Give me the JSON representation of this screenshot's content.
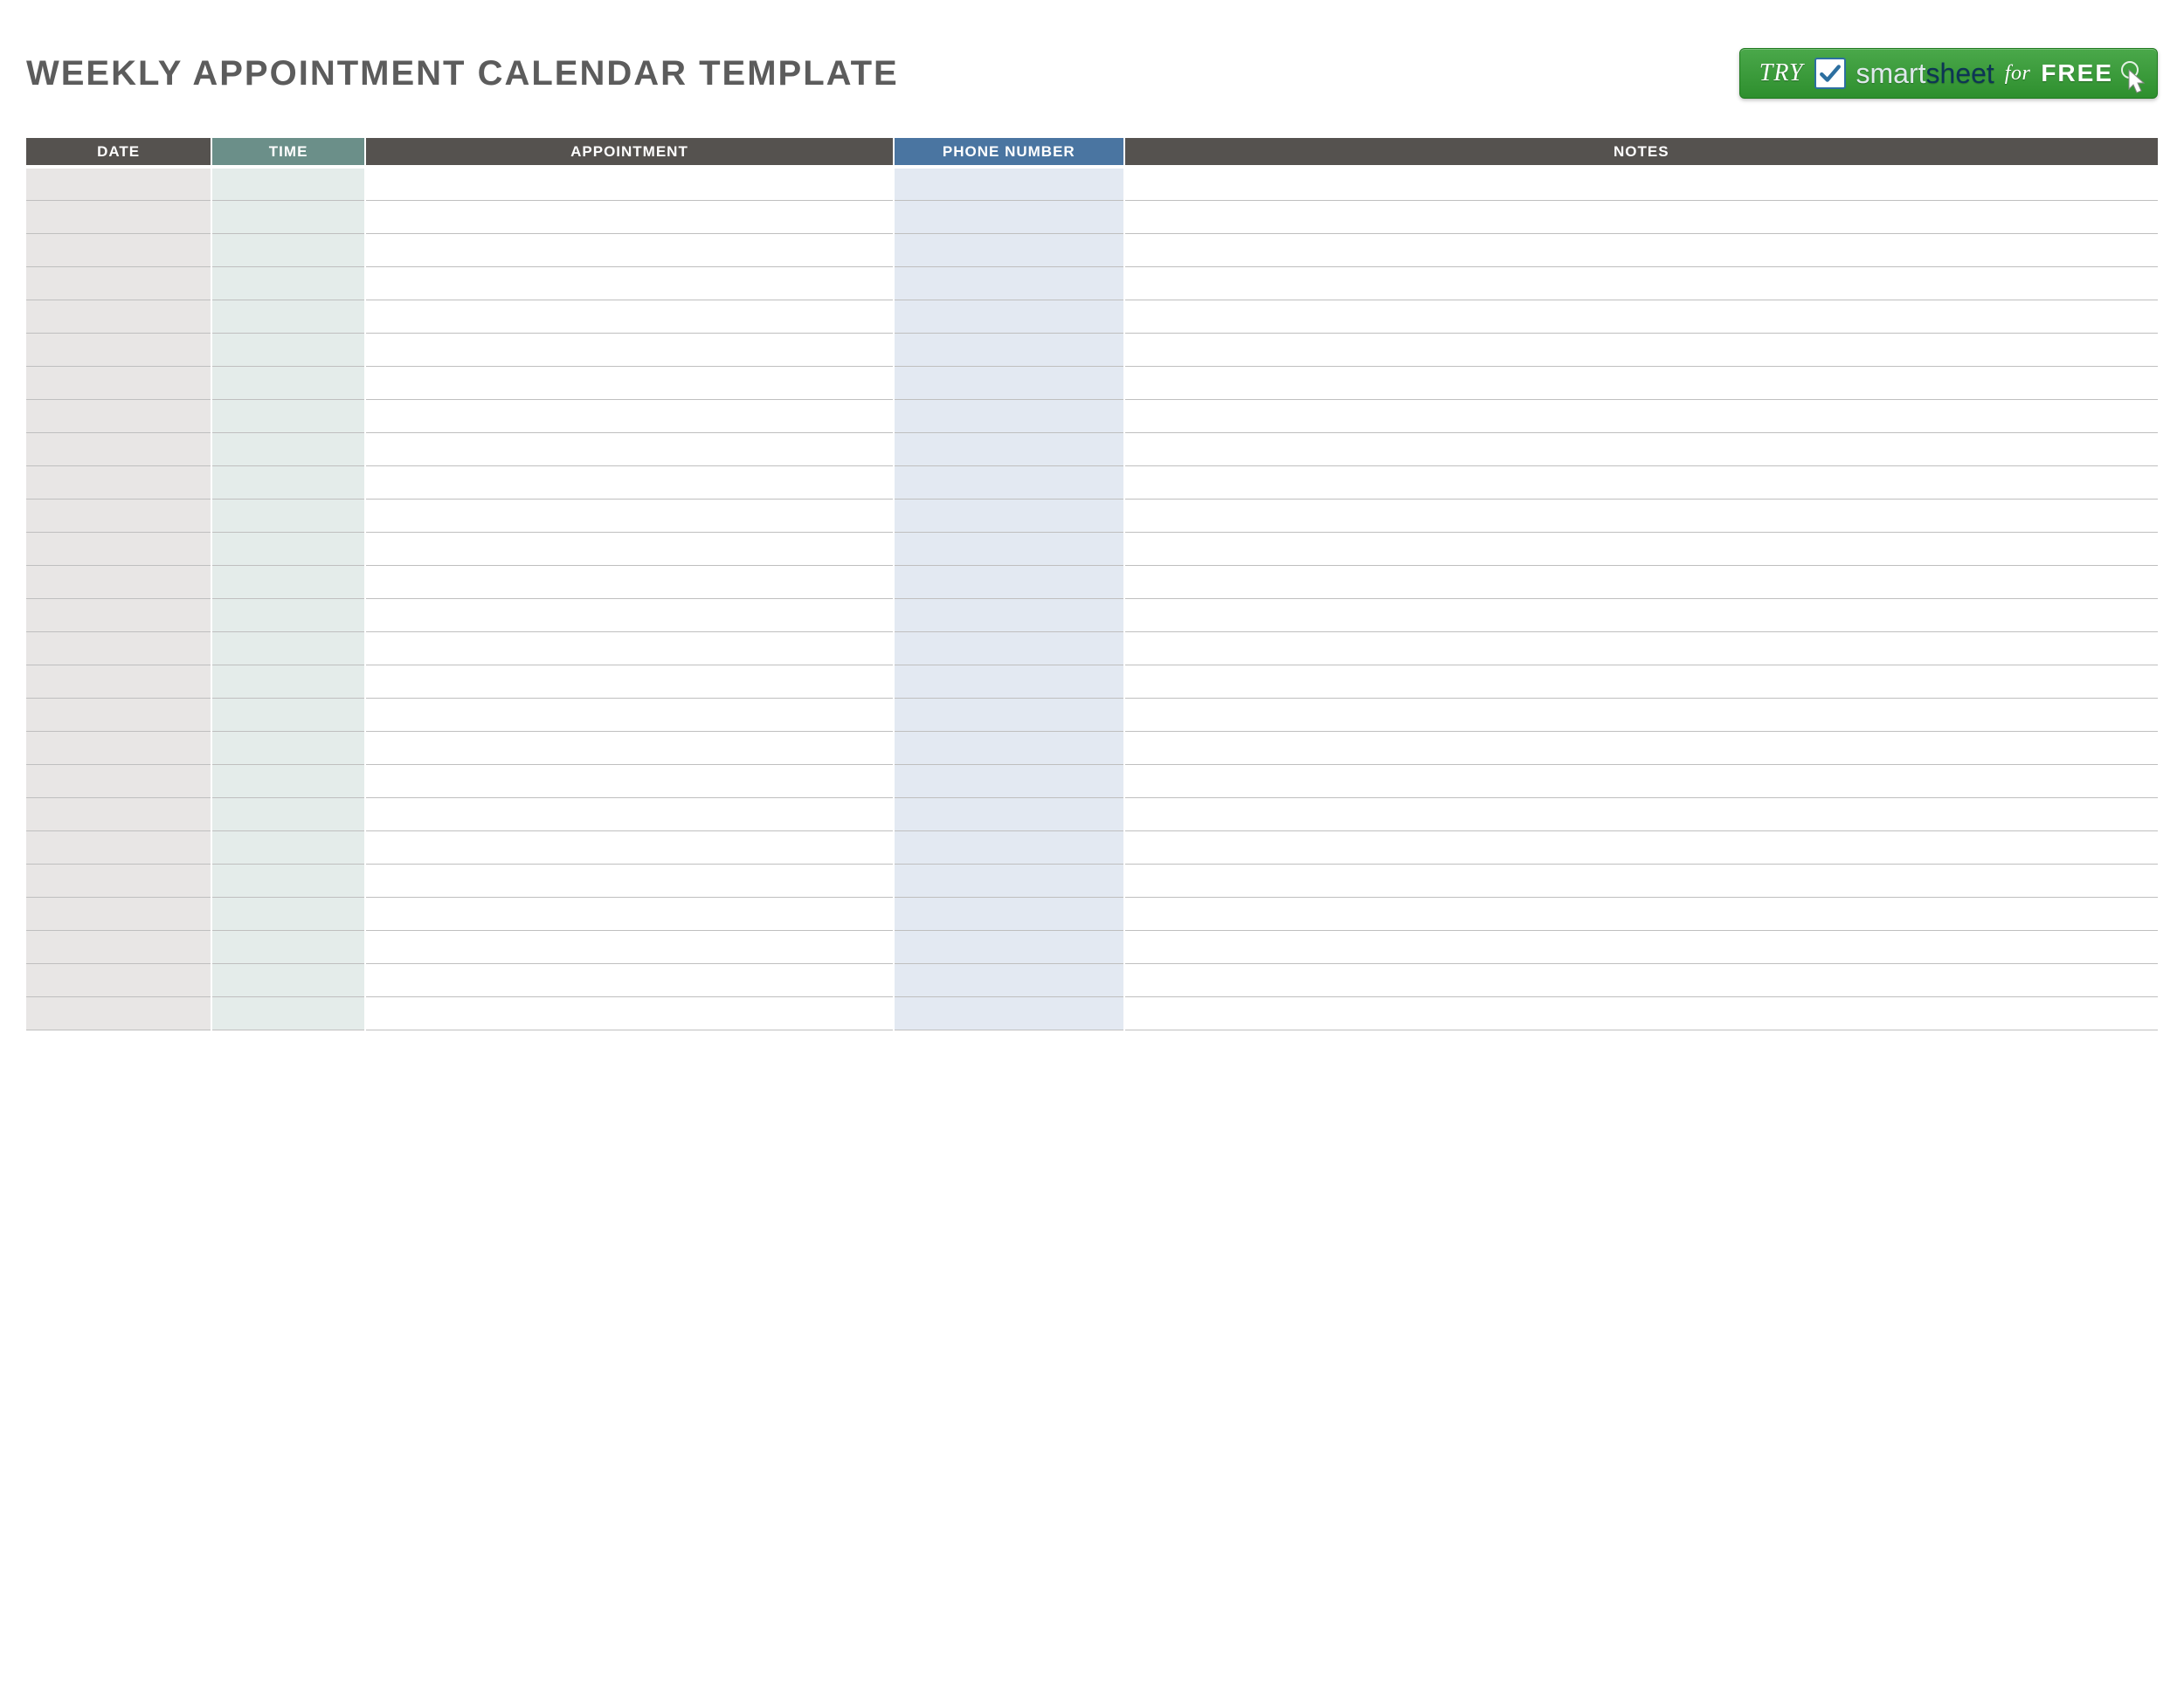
{
  "title": "WEEKLY APPOINTMENT CALENDAR TEMPLATE",
  "cta": {
    "try": "TRY",
    "brand_first": "smart",
    "brand_second": "sheet",
    "for": "for",
    "free": "FREE"
  },
  "columns": {
    "date": "DATE",
    "time": "TIME",
    "appointment": "APPOINTMENT",
    "phone": "PHONE NUMBER",
    "notes": "NOTES"
  },
  "rows": [
    {
      "date": "",
      "time": "",
      "appointment": "",
      "phone": "",
      "notes": ""
    },
    {
      "date": "",
      "time": "",
      "appointment": "",
      "phone": "",
      "notes": ""
    },
    {
      "date": "",
      "time": "",
      "appointment": "",
      "phone": "",
      "notes": ""
    },
    {
      "date": "",
      "time": "",
      "appointment": "",
      "phone": "",
      "notes": ""
    },
    {
      "date": "",
      "time": "",
      "appointment": "",
      "phone": "",
      "notes": ""
    },
    {
      "date": "",
      "time": "",
      "appointment": "",
      "phone": "",
      "notes": ""
    },
    {
      "date": "",
      "time": "",
      "appointment": "",
      "phone": "",
      "notes": ""
    },
    {
      "date": "",
      "time": "",
      "appointment": "",
      "phone": "",
      "notes": ""
    },
    {
      "date": "",
      "time": "",
      "appointment": "",
      "phone": "",
      "notes": ""
    },
    {
      "date": "",
      "time": "",
      "appointment": "",
      "phone": "",
      "notes": ""
    },
    {
      "date": "",
      "time": "",
      "appointment": "",
      "phone": "",
      "notes": ""
    },
    {
      "date": "",
      "time": "",
      "appointment": "",
      "phone": "",
      "notes": ""
    },
    {
      "date": "",
      "time": "",
      "appointment": "",
      "phone": "",
      "notes": ""
    },
    {
      "date": "",
      "time": "",
      "appointment": "",
      "phone": "",
      "notes": ""
    },
    {
      "date": "",
      "time": "",
      "appointment": "",
      "phone": "",
      "notes": ""
    },
    {
      "date": "",
      "time": "",
      "appointment": "",
      "phone": "",
      "notes": ""
    },
    {
      "date": "",
      "time": "",
      "appointment": "",
      "phone": "",
      "notes": ""
    },
    {
      "date": "",
      "time": "",
      "appointment": "",
      "phone": "",
      "notes": ""
    },
    {
      "date": "",
      "time": "",
      "appointment": "",
      "phone": "",
      "notes": ""
    },
    {
      "date": "",
      "time": "",
      "appointment": "",
      "phone": "",
      "notes": ""
    },
    {
      "date": "",
      "time": "",
      "appointment": "",
      "phone": "",
      "notes": ""
    },
    {
      "date": "",
      "time": "",
      "appointment": "",
      "phone": "",
      "notes": ""
    },
    {
      "date": "",
      "time": "",
      "appointment": "",
      "phone": "",
      "notes": ""
    },
    {
      "date": "",
      "time": "",
      "appointment": "",
      "phone": "",
      "notes": ""
    },
    {
      "date": "",
      "time": "",
      "appointment": "",
      "phone": "",
      "notes": ""
    },
    {
      "date": "",
      "time": "",
      "appointment": "",
      "phone": "",
      "notes": ""
    }
  ]
}
